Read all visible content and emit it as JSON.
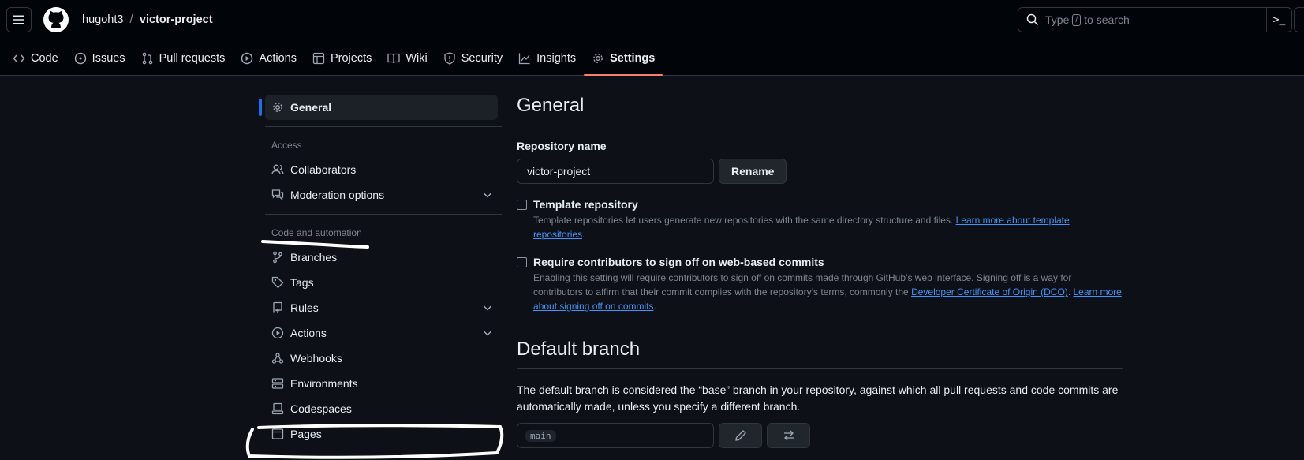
{
  "header": {
    "owner": "hugoht3",
    "separator": "/",
    "repo": "victor-project",
    "search_prefix": "Type",
    "search_key": "/",
    "search_suffix": "to search",
    "terminal_glyph": ">_"
  },
  "tabs": [
    {
      "label": "Code",
      "icon": "code-icon"
    },
    {
      "label": "Issues",
      "icon": "issue-icon"
    },
    {
      "label": "Pull requests",
      "icon": "pull-request-icon"
    },
    {
      "label": "Actions",
      "icon": "play-icon"
    },
    {
      "label": "Projects",
      "icon": "table-icon"
    },
    {
      "label": "Wiki",
      "icon": "book-icon"
    },
    {
      "label": "Security",
      "icon": "shield-icon"
    },
    {
      "label": "Insights",
      "icon": "graph-icon"
    },
    {
      "label": "Settings",
      "icon": "gear-icon"
    }
  ],
  "sidebar": {
    "general": "General",
    "access_heading": "Access",
    "collaborators": "Collaborators",
    "moderation": "Moderation options",
    "code_heading": "Code and automation",
    "branches": "Branches",
    "tags": "Tags",
    "rules": "Rules",
    "actions": "Actions",
    "webhooks": "Webhooks",
    "environments": "Environments",
    "codespaces": "Codespaces",
    "pages": "Pages"
  },
  "main": {
    "title": "General",
    "repo_name_label": "Repository name",
    "repo_name_value": "victor-project",
    "rename_label": "Rename",
    "template_title": "Template repository",
    "template_desc": "Template repositories let users generate new repositories with the same directory structure and files.",
    "template_link": "Learn more about template repositories",
    "signoff_title": "Require contributors to sign off on web-based commits",
    "signoff_desc1": "Enabling this setting will require contributors to sign off on commits made through GitHub’s web interface. Signing off is a way for contributors to affirm that their commit complies with the repository’s terms, commonly the",
    "signoff_link1": "Developer Certificate of Origin (DCO)",
    "signoff_link2": "Learn more about signing off on commits",
    "default_branch_title": "Default branch",
    "default_branch_desc": "The default branch is considered the “base” branch in your repository, against which all pull requests and code commits are automatically made, unless you specify a different branch.",
    "branch_value": "main"
  },
  "colors": {
    "background": "#0d1117",
    "header": "#010409",
    "accent_underline": "#f78166",
    "link": "#4493f8",
    "selected_bar": "#1f6feb",
    "annotation": "#ffffff"
  }
}
